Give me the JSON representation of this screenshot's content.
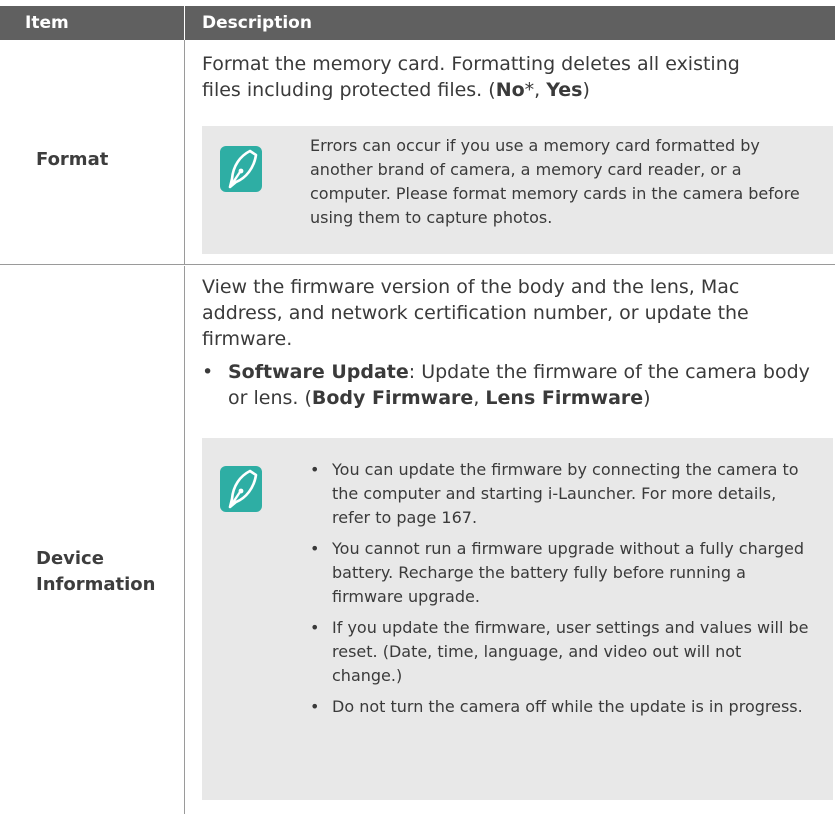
{
  "header": {
    "item_label": "Item",
    "description_label": "Description"
  },
  "rows": [
    {
      "item": "Format",
      "description": {
        "line1": "Format the memory card. Formatting deletes all existing",
        "line2_pre": "files including protected files. (",
        "opt1": "No",
        "opt1_suffix": "*, ",
        "opt2": "Yes",
        "line2_post": ")"
      },
      "note": "Errors can occur if you use a memory card formatted by another brand of camera, a memory card reader, or a computer. Please format memory cards in the camera before using them to capture photos."
    },
    {
      "item_line1": "Device",
      "item_line2": "Information",
      "description": "View the firmware version of the body and the lens, Mac address, and network certification number, or update the firmware.",
      "bullet": {
        "title": "Software Update",
        "text": ": Update the firmware of the camera body or lens. (",
        "opt1": "Body Firmware",
        "sep": ", ",
        "opt2": "Lens Firmware",
        "close": ")"
      },
      "notes": [
        "You can update the firmware by connecting the camera to the computer and starting i-Launcher. For more details, refer to page 167.",
        "You cannot run a firmware upgrade without a fully charged battery. Recharge the battery fully before running a firmware upgrade.",
        "If you update the firmware, user settings and values will be reset. (Date, time, language, and video out will not change.)",
        "Do not turn the camera off while the update is in progress."
      ]
    }
  ],
  "colors": {
    "header_bg": "#606060",
    "note_bg": "#e8e8e8",
    "icon": "#2eaea4"
  }
}
